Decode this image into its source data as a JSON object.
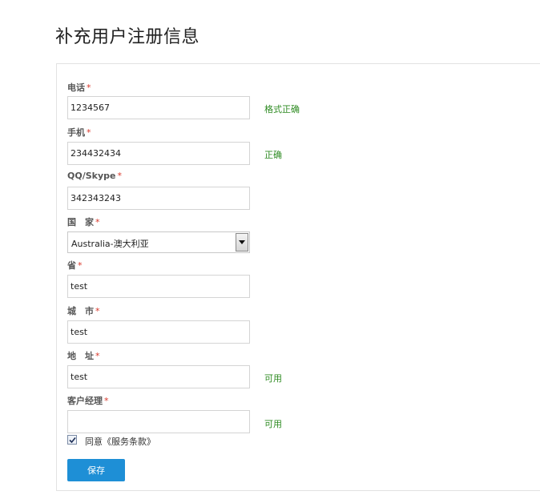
{
  "page": {
    "title": "补充用户注册信息"
  },
  "form": {
    "required_mark": "*",
    "phone": {
      "label": "电话",
      "value": "1234567",
      "hint": "格式正确"
    },
    "mobile": {
      "label": "手机",
      "value": "234432434",
      "hint": "正确"
    },
    "qq_skype": {
      "label": "QQ/Skype",
      "value": "342343243"
    },
    "country": {
      "label": "国　家",
      "selected": "Australia-澳大利亚"
    },
    "province": {
      "label": "省",
      "value": "test"
    },
    "city": {
      "label": "城　市",
      "value": "test"
    },
    "address": {
      "label": "地　址",
      "value": "test",
      "hint": "可用"
    },
    "account_manager": {
      "label": "客户经理",
      "value": "",
      "hint": "可用"
    },
    "agree": {
      "label": "同意《服务条款》",
      "checked": true
    },
    "save_label": "保存"
  },
  "colors": {
    "accent": "#1e8fd6",
    "success": "#2e8b22",
    "required": "#d9372a"
  }
}
